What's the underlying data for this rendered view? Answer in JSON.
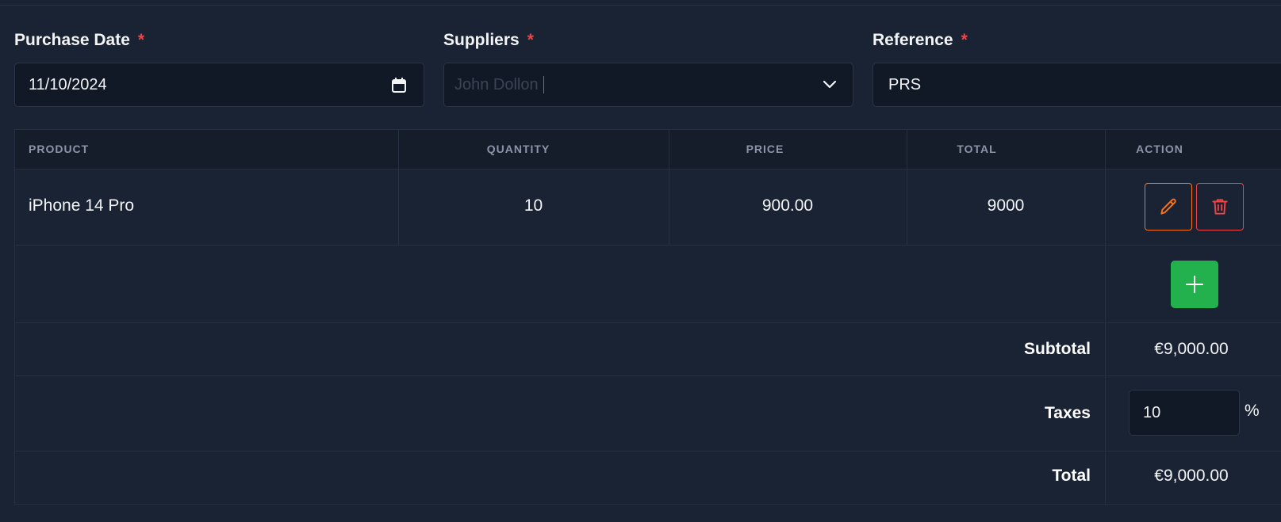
{
  "form": {
    "purchase_date": {
      "label": "Purchase Date",
      "required_mark": "*",
      "value": "11/10/2024"
    },
    "suppliers": {
      "label": "Suppliers",
      "required_mark": "*",
      "placeholder": "John Dollon"
    },
    "reference": {
      "label": "Reference",
      "required_mark": "*",
      "value": "PRS"
    }
  },
  "table": {
    "columns": [
      "PRODUCT",
      "QUANTITY",
      "PRICE",
      "TOTAL",
      "ACTION"
    ],
    "rows": [
      {
        "product": "iPhone 14 Pro",
        "quantity": "10",
        "price": "900.00",
        "total": "9000"
      }
    ]
  },
  "summary": {
    "subtotal_label": "Subtotal",
    "subtotal_value": "€9,000.00",
    "taxes_label": "Taxes",
    "taxes_value": "10",
    "taxes_unit": "%",
    "total_label": "Total",
    "total_value": "€9,000.00"
  },
  "colors": {
    "background": "#1a2333",
    "edit_accent": "#f97316",
    "delete_accent": "#ef4444",
    "add_button": "#22b14c",
    "required": "#ef4444"
  },
  "icons": [
    "calendar-icon",
    "chevron-down-icon",
    "pencil-icon",
    "trash-icon",
    "plus-icon"
  ]
}
